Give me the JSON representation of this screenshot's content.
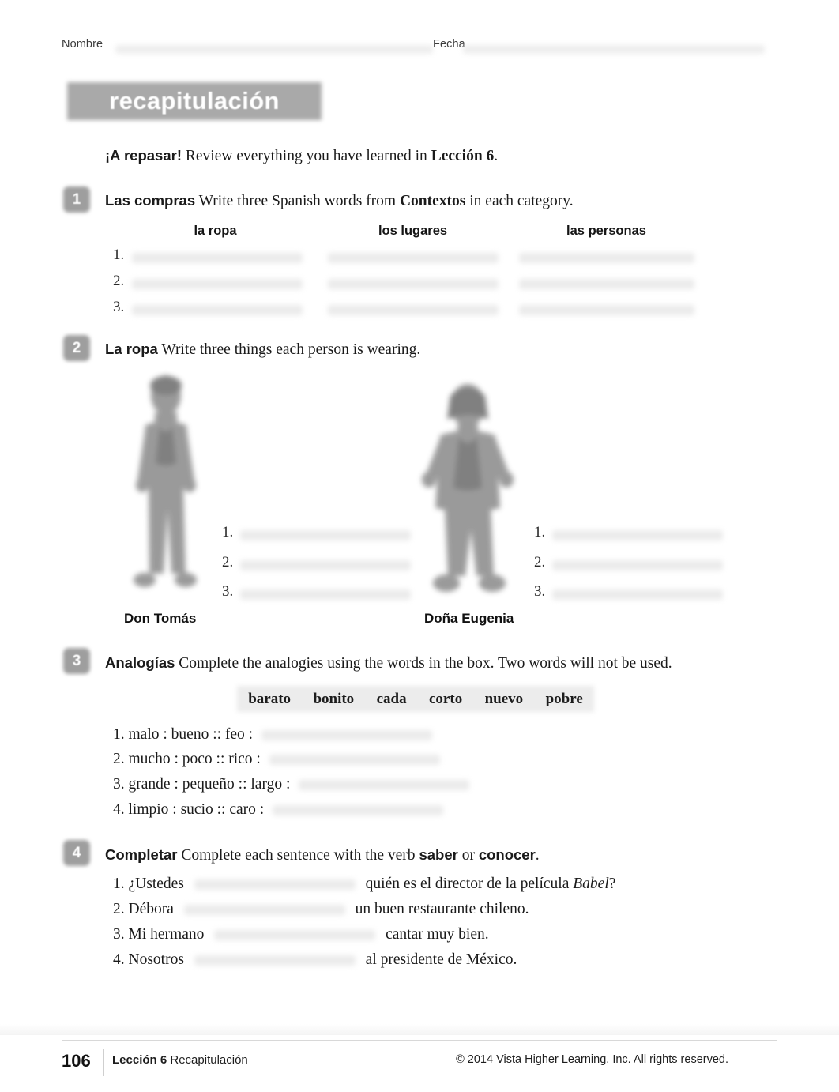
{
  "header": {
    "nombre_label": "Nombre",
    "fecha_label": "Fecha"
  },
  "title": "recapitulación",
  "intro": {
    "lead": "¡A repasar!",
    "body_before": "Review everything you have learned in ",
    "emphasis": "Lección 6",
    "body_after": "."
  },
  "activities": [
    {
      "number": "1",
      "title": "Las compras",
      "instruction_before": "Write three Spanish words from ",
      "instruction_emphasis": "Contextos",
      "instruction_after": " in each category.",
      "columns": [
        "la ropa",
        "los lugares",
        "las personas"
      ],
      "rows": [
        "1.",
        "2.",
        "3."
      ]
    },
    {
      "number": "2",
      "title": "La ropa",
      "instruction": "Write three things each person is wearing.",
      "left_figure_caption": "Don Tomás",
      "right_figure_caption": "Doña Eugenia",
      "left_items": [
        "1.",
        "2.",
        "3."
      ],
      "right_items": [
        "1.",
        "2.",
        "3."
      ]
    },
    {
      "number": "3",
      "title": "Analogías",
      "instruction": "Complete the analogies using the words in the box. Two words will not be used.",
      "word_bank": [
        "barato",
        "bonito",
        "cada",
        "corto",
        "nuevo",
        "pobre"
      ],
      "items": [
        {
          "index": "1.",
          "text": "malo : bueno :: feo :"
        },
        {
          "index": "2.",
          "text": "mucho : poco :: rico :"
        },
        {
          "index": "3.",
          "text": "grande : pequeño :: largo :"
        },
        {
          "index": "4.",
          "text": "limpio : sucio :: caro :"
        }
      ]
    },
    {
      "number": "4",
      "title": "Completar",
      "instruction_before": "Complete each sentence with the verb ",
      "instruction_verb1": "saber",
      "instruction_mid": " or ",
      "instruction_verb2": "conocer",
      "instruction_after": ".",
      "items": [
        {
          "index": "1.",
          "pre": "¿Ustedes",
          "post": "quién es el director de la película ",
          "italic": "Babel",
          "tail": "?"
        },
        {
          "index": "2.",
          "pre": "Débora",
          "post": "un buen restaurante chileno.",
          "italic": "",
          "tail": ""
        },
        {
          "index": "3.",
          "pre": "Mi hermano",
          "post": "cantar muy bien.",
          "italic": "",
          "tail": ""
        },
        {
          "index": "4.",
          "pre": "Nosotros",
          "post": "al presidente de México.",
          "italic": "",
          "tail": ""
        }
      ]
    }
  ],
  "footer": {
    "page_number": "106",
    "lesson": "Lección 6",
    "section": "Recapitulación",
    "copyright": "© 2014 Vista Higher Learning, Inc. All rights reserved."
  }
}
